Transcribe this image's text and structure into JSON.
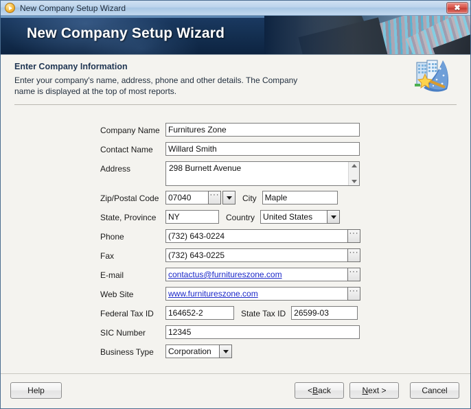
{
  "window": {
    "title": "New Company Setup Wizard",
    "icon": "wizard-orb-icon",
    "close_label": "✖"
  },
  "banner": {
    "title": "New Company Setup Wizard",
    "image": "skyscraper-photo"
  },
  "description": {
    "heading": "Enter Company Information",
    "body": "Enter your company's name, address, phone and other details. The Company name is displayed at the top of most reports.",
    "icon": "wizard-hat-building-icon"
  },
  "form": {
    "company_name": {
      "label": "Company Name",
      "value": "Furnitures Zone"
    },
    "contact_name": {
      "label": "Contact Name",
      "value": "Willard Smith"
    },
    "address": {
      "label": "Address",
      "value": "298 Burnett Avenue"
    },
    "zip": {
      "label": "Zip/Postal Code",
      "value": "07040"
    },
    "city": {
      "label": "City",
      "value": "Maple"
    },
    "state": {
      "label": "State, Province",
      "value": "NY"
    },
    "country": {
      "label": "Country",
      "value": "United States"
    },
    "phone": {
      "label": "Phone",
      "value": "(732) 643-0224"
    },
    "fax": {
      "label": "Fax",
      "value": "(732) 643-0225"
    },
    "email": {
      "label": "E-mail",
      "value": "contactus@furnitureszone.com"
    },
    "website": {
      "label": "Web Site",
      "value": "www.furnitureszone.com"
    },
    "federal_tax_id": {
      "label": "Federal Tax ID",
      "value": "164652-2"
    },
    "state_tax_id": {
      "label": "State Tax ID",
      "value": "26599-03"
    },
    "sic_number": {
      "label": "SIC Number",
      "value": "12345"
    },
    "business_type": {
      "label": "Business Type",
      "value": "Corporation"
    },
    "ellipsis_label": "···"
  },
  "footer": {
    "help": "Help",
    "back_prefix": "< ",
    "back_accel": "B",
    "back_suffix": "ack",
    "next_accel": "N",
    "next_suffix": "ext >",
    "cancel": "Cancel"
  },
  "colors": {
    "banner_dark": "#0d2340",
    "banner_mid": "#1b3a63",
    "page_bg": "#f4f3ef",
    "link": "#1a27c8",
    "heading": "#1f3552",
    "close_red": "#d9544a"
  }
}
